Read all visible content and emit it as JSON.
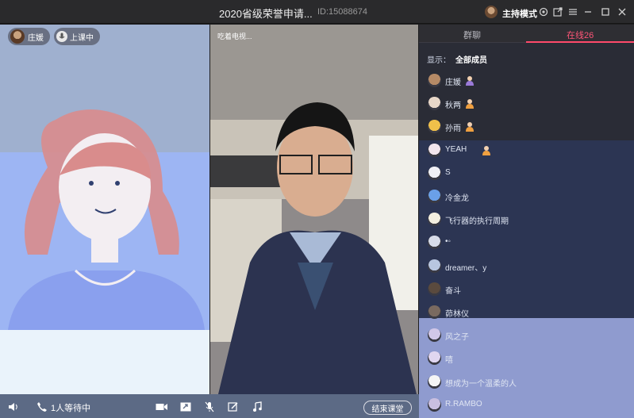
{
  "window": {
    "title": "2020省级荣誉申请...",
    "room_id": "ID:15088674",
    "host_mode_label": "主持模式",
    "icons": [
      "settings-icon",
      "share-icon",
      "menu-icon",
      "minimize-icon",
      "maximize-icon",
      "close-icon"
    ]
  },
  "left_video": {
    "user_name": "庄媛",
    "status_label": "上课中"
  },
  "center_video": {
    "label": "吃着电视..."
  },
  "bottombar": {
    "waiting_text": "1人等待中",
    "end_class_label": "结束课堂",
    "icons": [
      "volume-icon",
      "phone-icon",
      "camera-icon",
      "screen-share-icon",
      "mic-icon",
      "whiteboard-icon",
      "music-icon"
    ]
  },
  "sidebar": {
    "tabs": [
      {
        "label": "群聊",
        "active": false
      },
      {
        "label": "在线26",
        "active": true
      }
    ],
    "filter_label": "显示：",
    "filter_value": "全部成员",
    "members": [
      {
        "name": "庄媛",
        "role": "teacher",
        "avatar_color": "#b58a66"
      },
      {
        "name": "秋两",
        "role": "student",
        "avatar_color": "#e8d7c8"
      },
      {
        "name": "孙雨",
        "role": "student",
        "avatar_color": "#f0c04a"
      },
      {
        "name": "YEAH",
        "role": "student",
        "avatar_color": "#f2e6ee"
      },
      {
        "name": "S",
        "role": "",
        "avatar_color": "#f0f0f5"
      },
      {
        "name": "冷金龙",
        "role": "",
        "avatar_color": "#6aa0e8"
      },
      {
        "name": "飞行器的执行周期",
        "role": "",
        "avatar_color": "#f3efe0"
      },
      {
        "name": "•◦",
        "role": "",
        "avatar_color": "#d7dbe8"
      },
      {
        "name": "dreamer、y",
        "role": "",
        "avatar_color": "#b8c6e0"
      },
      {
        "name": "奋斗",
        "role": "",
        "avatar_color": "#5a4a3e"
      },
      {
        "name": "茆林仪",
        "role": "",
        "avatar_color": "#7a6a60"
      },
      {
        "name": "风之子",
        "role": "",
        "avatar_color": "#d1c7e8"
      },
      {
        "name": "嘻",
        "role": "",
        "avatar_color": "#e0d6f0"
      },
      {
        "name": "想成为一个温柔的人",
        "role": "",
        "avatar_color": "#f5f5f5"
      },
      {
        "name": "R.RAMBO",
        "role": "",
        "avatar_color": "#c9bfe0"
      }
    ]
  },
  "colors": {
    "accent": "#ff4a6b",
    "titlebar": "#2a2a2c",
    "bottombar": "#5c6a85"
  }
}
